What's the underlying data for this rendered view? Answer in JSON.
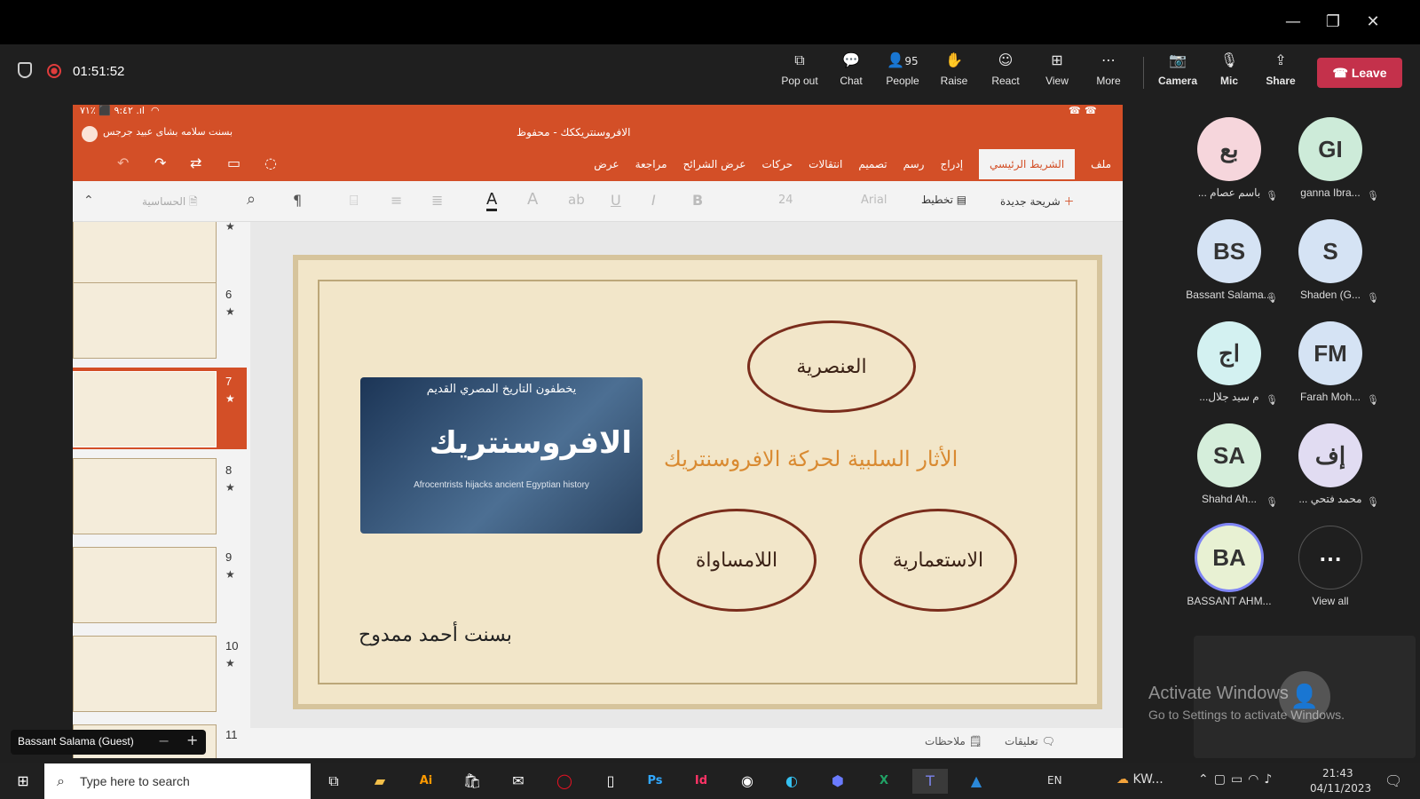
{
  "window": {
    "minimize": "—",
    "restore": "❐",
    "close": "✕"
  },
  "meeting": {
    "timer": "01:51:52"
  },
  "toolbar": {
    "popout": "Pop out",
    "chat": "Chat",
    "people": "People",
    "people_count": "95",
    "raise": "Raise",
    "react": "React",
    "view": "View",
    "more": "More",
    "camera": "Camera",
    "mic": "Mic",
    "share": "Share",
    "leave": "Leave"
  },
  "ppt": {
    "status": "٩:٤٢ ⬛ ٪٧١ .ıl",
    "doc_title": "الافروسنتريككك - محفوظ",
    "user": "بسنت سلامه بشاى عبيد جرجس",
    "tabs": [
      "ملف",
      "الشريط الرئيسي",
      "إدراج",
      "رسم",
      "تصميم",
      "انتقالات",
      "حركات",
      "عرض الشرائح",
      "مراجعة",
      "عرض"
    ],
    "new_slide": "شريحة جديدة",
    "layout": "تخطيط",
    "font": "Arial",
    "size": "24",
    "sensitivity": "الحساسية",
    "thumb_numbers": [
      "6",
      "7",
      "8",
      "9",
      "10",
      "11"
    ],
    "notes": "ملاحظات",
    "comments": "تعليقات"
  },
  "slide": {
    "title": "الأثار السلبية لحركة الافروسنتريك",
    "ellipses": [
      "العنصرية",
      "اللامساواة",
      "الاستعمارية"
    ],
    "image_top": "يخطفون التاريخ المصري القديم",
    "image_big": "الافروسنتريك",
    "image_sub": "Afrocentrists hijacks ancient Egyptian history",
    "author": "بسنت أحمد ممدوح"
  },
  "presenter_label": "Bassant Salama (Guest)",
  "participants": [
    {
      "initials": "بع",
      "name": "... باسم عصام",
      "color": "#f6d6dc"
    },
    {
      "initials": "GI",
      "name": "ganna Ibra...",
      "color": "#cdebd9"
    },
    {
      "initials": "BS",
      "name": "Bassant Salama...",
      "color": "#d5e3f4"
    },
    {
      "initials": "S",
      "name": "Shaden (G...",
      "color": "#d5e3f4"
    },
    {
      "initials": "اج",
      "name": "...م سيد جلال",
      "color": "#d3f1f1"
    },
    {
      "initials": "FM",
      "name": "Farah Moh...",
      "color": "#d5e3f4"
    },
    {
      "initials": "SA",
      "name": "Shahd Ah...",
      "color": "#d5eedb"
    },
    {
      "initials": "إف",
      "name": "... محمد فتحي",
      "color": "#e1dcf2"
    },
    {
      "initials": "BA",
      "name": "BASSANT AHM...",
      "color": "#e8f1d3"
    }
  ],
  "view_all": "View all",
  "watermark": {
    "title": "Activate Windows",
    "sub": "Go to Settings to activate Windows."
  },
  "taskbar": {
    "search": "Type here to search",
    "lang": "EN",
    "weather": "KW...",
    "time": "21:43",
    "date": "04/11/2023"
  }
}
